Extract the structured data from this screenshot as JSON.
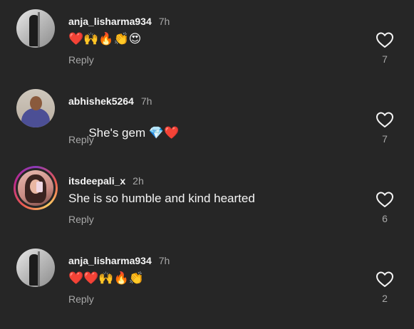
{
  "comments": [
    {
      "username": "anja_lisharma934",
      "time": "7h",
      "text": "",
      "emoji": "❤️🙌🔥👏😍",
      "reply": "Reply",
      "likes": "7",
      "avatar": "bw"
    },
    {
      "username": "abhishek5264",
      "time": "7h",
      "text": "She's gem ",
      "emoji": "💎❤️",
      "reply": "Reply",
      "likes": "7",
      "avatar": "man"
    },
    {
      "username": "itsdeepali_x",
      "time": "2h",
      "text": "She is so humble and kind hearted",
      "emoji": "",
      "reply": "Reply",
      "likes": "6",
      "avatar": "girl-story"
    },
    {
      "username": "anja_lisharma934",
      "time": "7h",
      "text": "",
      "emoji": "❤️❤️🙌🔥👏",
      "reply": "Reply",
      "likes": "2",
      "avatar": "bw"
    }
  ],
  "icons": {
    "like": "heart-outline-icon"
  },
  "colors": {
    "background": "#262626",
    "text": "#f5f5f5",
    "secondary": "#a8a8a8"
  }
}
